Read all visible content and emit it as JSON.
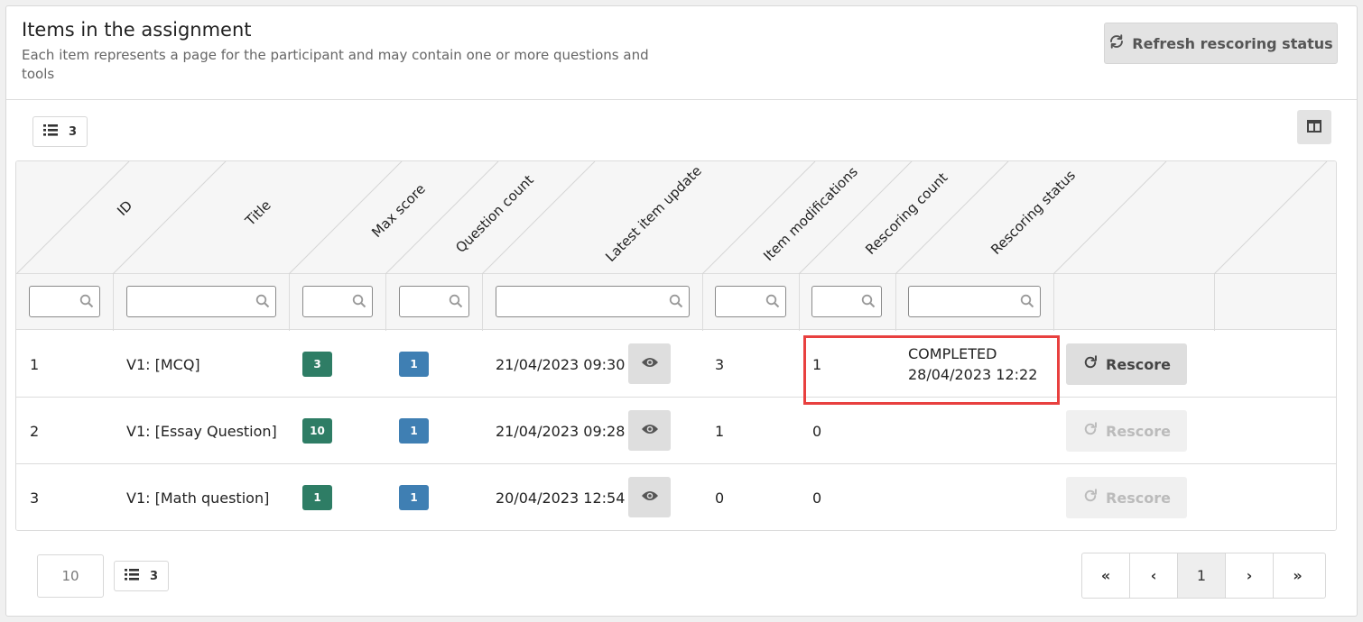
{
  "panel": {
    "title": "Items in the assignment",
    "description": "Each item represents a page for the participant and may contain one or more questions and tools",
    "refresh_label": "Refresh rescoring status"
  },
  "toolbar": {
    "row_count": "3"
  },
  "table": {
    "columns": [
      "ID",
      "Title",
      "Max score",
      "Question count",
      "Latest item update",
      "Item modifications",
      "Rescoring count",
      "Rescoring status"
    ],
    "rows": [
      {
        "id": "1",
        "title": "V1: [MCQ]",
        "max_score": "3",
        "question_count": "1",
        "latest_update": "21/04/2023 09:30",
        "modifications": "3",
        "rescoring_count": "1",
        "status_line1": "COMPLETED",
        "status_line2": "28/04/2023 12:22",
        "rescore_label": "Rescore",
        "rescore_enabled": true
      },
      {
        "id": "2",
        "title": "V1: [Essay Question]",
        "max_score": "10",
        "question_count": "1",
        "latest_update": "21/04/2023 09:28",
        "modifications": "1",
        "rescoring_count": "0",
        "status_line1": "",
        "status_line2": "",
        "rescore_label": "Rescore",
        "rescore_enabled": false
      },
      {
        "id": "3",
        "title": "V1: [Math question]",
        "max_score": "1",
        "question_count": "1",
        "latest_update": "20/04/2023 12:54",
        "modifications": "0",
        "rescoring_count": "0",
        "status_line1": "",
        "status_line2": "",
        "rescore_label": "Rescore",
        "rescore_enabled": false
      }
    ]
  },
  "footer": {
    "page_size": "10",
    "row_count": "3",
    "pagination": {
      "first": "«",
      "prev": "‹",
      "current": "1",
      "next": "›",
      "last": "»"
    }
  },
  "colors": {
    "max_score_badge": "#2e7d65",
    "question_badge": "#3f7fb3",
    "highlight": "#e8403f"
  }
}
